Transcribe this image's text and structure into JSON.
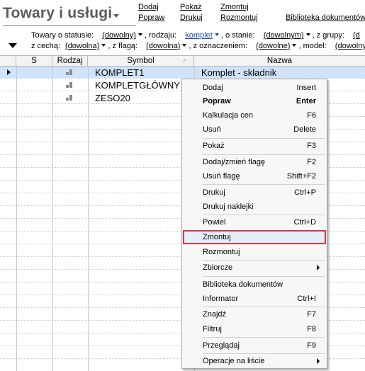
{
  "header": {
    "title": "Towary i usługi",
    "links_col1": [
      "Dodaj",
      "Popraw"
    ],
    "links_col2": [
      "Pokaż",
      "Drukuj"
    ],
    "links_col3": [
      "Zmontuj",
      "Rozmontuj"
    ],
    "links_col4": "Biblioteka dokumentów"
  },
  "filters": {
    "row1": {
      "status_label": "Towary o statusie:",
      "status_value": "(dowolny)",
      "kind_label": ", rodzaju:",
      "kind_value": "komplet",
      "state_label": ", o stanie:",
      "state_value": "(dowolnym)",
      "group_label": ", z grupy:",
      "group_value": "(d"
    },
    "row2": {
      "feature_label": "z cechą:",
      "feature_value": "(dowolna)",
      "flag_label": ", z flagą:",
      "flag_value": "(dowolna)",
      "mark_label": ", z oznaczeniem:",
      "mark_value": "(dowolne)",
      "model_label": ", model:",
      "model_value": "(dowolny)"
    }
  },
  "grid": {
    "columns": [
      "S",
      "Rodzaj",
      "Symbol",
      "Nazwa"
    ],
    "rows": [
      {
        "symbol": "KOMPLET1",
        "name": "Komplet - składnik",
        "selected": true,
        "kind_icon": "set-icon"
      },
      {
        "symbol": "KOMPLETGŁÓWNY",
        "name": "",
        "selected": false,
        "kind_icon": "set-icon"
      },
      {
        "symbol": "ZESO20",
        "name": "",
        "selected": false,
        "kind_icon": "set-icon"
      }
    ]
  },
  "context_menu": {
    "items": [
      {
        "label": "Dodaj",
        "shortcut": "Insert"
      },
      {
        "label": "Popraw",
        "shortcut": "Enter",
        "bold": true
      },
      {
        "label": "Kalkulacja cen",
        "shortcut": "F6"
      },
      {
        "label": "Usuń",
        "shortcut": "Delete"
      },
      {
        "label": "Pokaż",
        "shortcut": "F3"
      },
      {
        "label": "Dodaj/zmień flagę",
        "shortcut": "F2"
      },
      {
        "label": "Usuń flagę",
        "shortcut": "Shift+F2"
      },
      {
        "label": "Drukuj",
        "shortcut": "Ctrl+P"
      },
      {
        "label": "Drukuj naklejki",
        "shortcut": ""
      },
      {
        "label": "Powiel",
        "shortcut": "Ctrl+D"
      },
      {
        "label": "Zmontuj",
        "shortcut": "",
        "highlighted": true
      },
      {
        "label": "Rozmontuj",
        "shortcut": ""
      },
      {
        "label": "Zbiorcze",
        "shortcut": "",
        "submenu": true
      },
      {
        "label": "Biblioteka dokumentów",
        "shortcut": ""
      },
      {
        "label": "Informator",
        "shortcut": "Ctrl+I"
      },
      {
        "label": "Znajdź",
        "shortcut": "F7"
      },
      {
        "label": "Filtruj",
        "shortcut": "F8"
      },
      {
        "label": "Przeglądaj",
        "shortcut": "F9"
      },
      {
        "label": "Operacje na liście",
        "shortcut": "",
        "submenu": true
      }
    ]
  },
  "colors": {
    "selected_row": "#cfe4fb",
    "highlight_border": "#e0353a",
    "active_filter": "#1a4fb8"
  }
}
